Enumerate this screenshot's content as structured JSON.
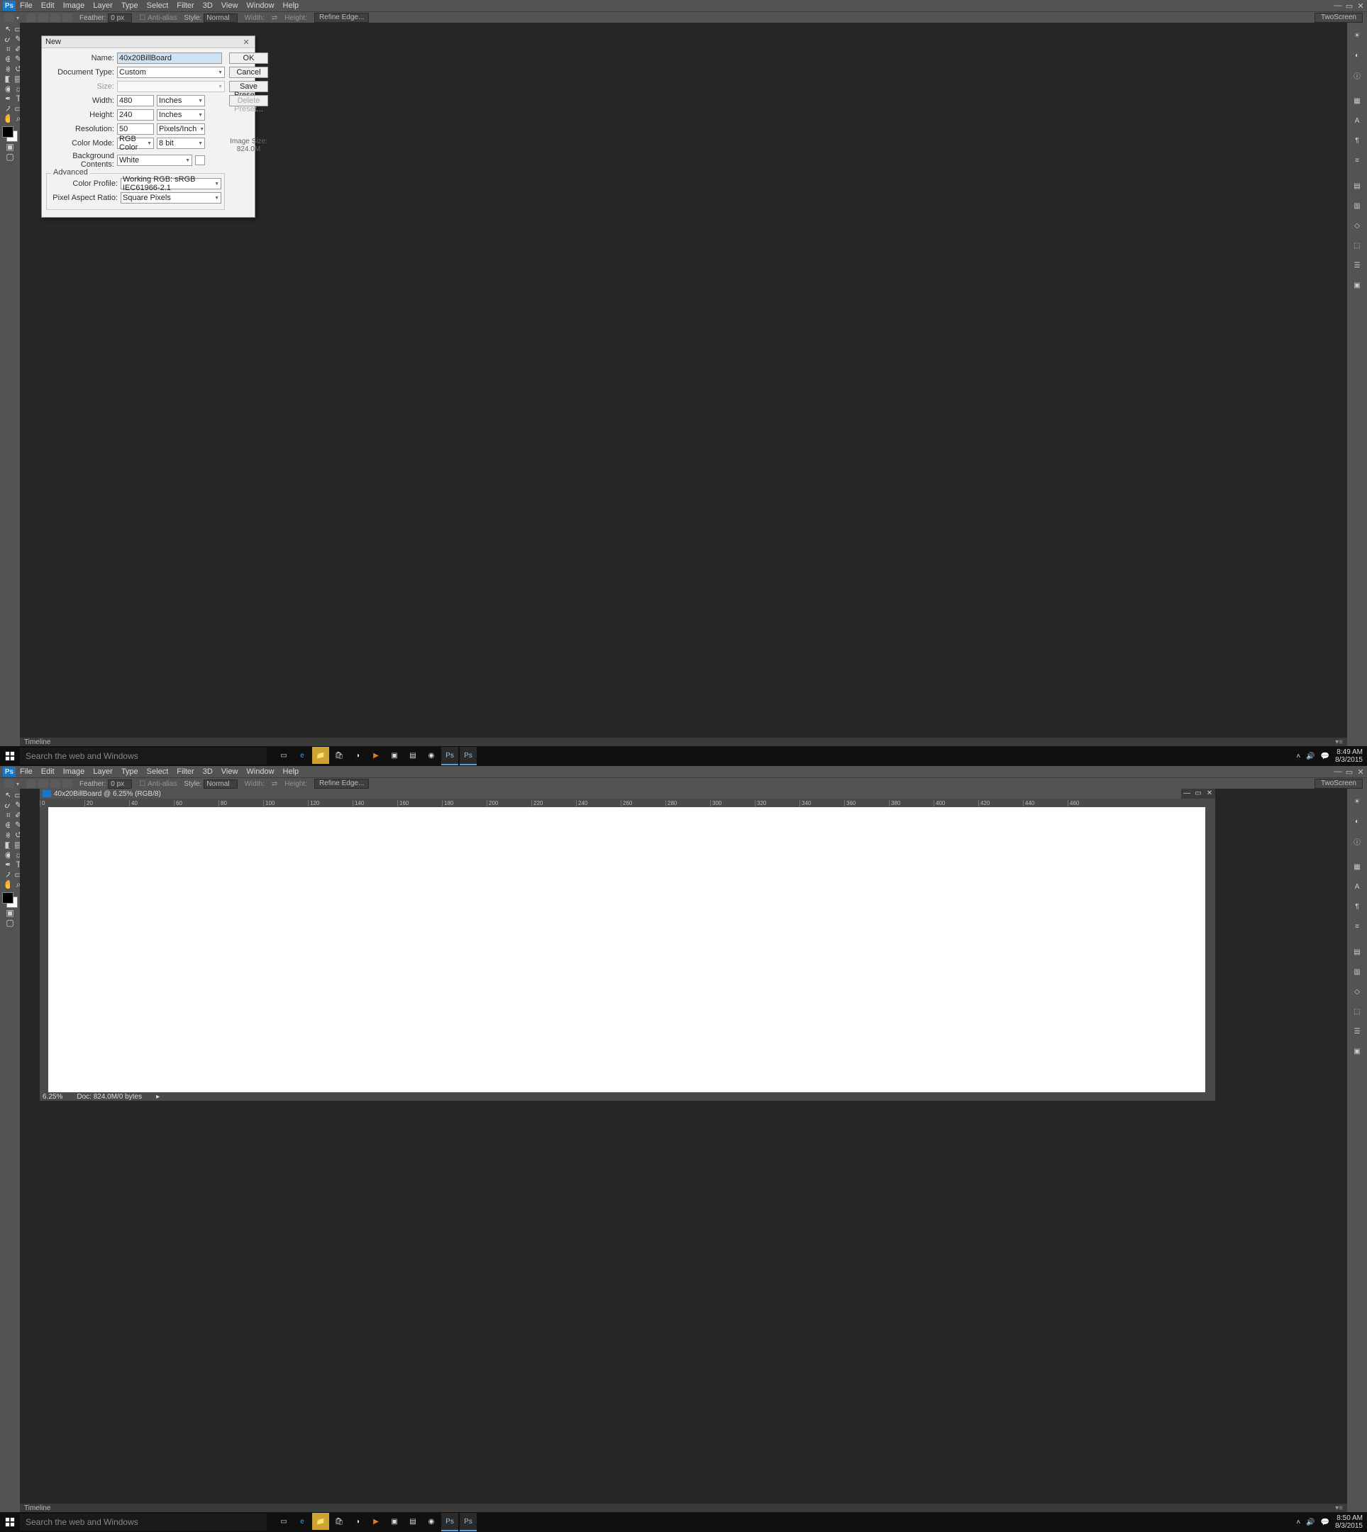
{
  "menus": [
    "File",
    "Edit",
    "Image",
    "Layer",
    "Type",
    "Select",
    "Filter",
    "3D",
    "View",
    "Window",
    "Help"
  ],
  "optbar": {
    "feather_label": "Feather:",
    "feather_value": "0 px",
    "antialias": "Anti-alias",
    "style_label": "Style:",
    "style_value": "Normal",
    "width_label": "Width:",
    "height_label": "Height:",
    "refine": "Refine Edge...",
    "twoscreen": "TwoScreen"
  },
  "timeline_label": "Timeline",
  "tools": [
    "move",
    "marquee",
    "lasso",
    "quick-select",
    "crop",
    "eyedropper",
    "spot-heal",
    "brush",
    "clone-stamp",
    "history-brush",
    "eraser",
    "gradient",
    "blur",
    "dodge",
    "pen",
    "type",
    "path-select",
    "shape",
    "hand",
    "zoom"
  ],
  "right_panels": [
    "history",
    "brightness",
    "info",
    "color",
    "swatches",
    "type",
    "paragraph",
    "layers",
    "channels",
    "paths",
    "doc",
    "styles",
    "3d",
    "adjust",
    "timeline",
    "measurement"
  ],
  "dialog": {
    "title": "New",
    "name_label": "Name:",
    "name_value": "40x20BillBoard",
    "doctype_label": "Document Type:",
    "doctype_value": "Custom",
    "size_label": "Size:",
    "size_value": "",
    "width_label": "Width:",
    "width_value": "480",
    "width_unit": "Inches",
    "height_label": "Height:",
    "height_value": "240",
    "height_unit": "Inches",
    "res_label": "Resolution:",
    "res_value": "50",
    "res_unit": "Pixels/Inch",
    "mode_label": "Color Mode:",
    "mode_value": "RGB Color",
    "mode_bits": "8 bit",
    "bg_label": "Background Contents:",
    "bg_value": "White",
    "advanced": "Advanced",
    "profile_label": "Color Profile:",
    "profile_value": "Working RGB: sRGB IEC61966-2.1",
    "par_label": "Pixel Aspect Ratio:",
    "par_value": "Square Pixels",
    "ok": "OK",
    "cancel": "Cancel",
    "save_preset": "Save Preset...",
    "delete_preset": "Delete Preset...",
    "img_size_label": "Image Size:",
    "img_size": "824.0M"
  },
  "doc": {
    "title": "40x20BillBoard @ 6.25% (RGB/8)",
    "ruler": [
      "0",
      "20",
      "40",
      "60",
      "80",
      "100",
      "120",
      "140",
      "160",
      "180",
      "200",
      "220",
      "240",
      "260",
      "280",
      "300",
      "320",
      "340",
      "360",
      "380",
      "400",
      "420",
      "440",
      "460"
    ],
    "zoom": "6.25%",
    "docinfo": "Doc: 824.0M/0 bytes"
  },
  "search_placeholder": "Search the web and Windows",
  "clock1": {
    "time": "8:49 AM",
    "date": "8/3/2015"
  },
  "clock2": {
    "time": "8:50 AM",
    "date": "8/3/2015"
  }
}
